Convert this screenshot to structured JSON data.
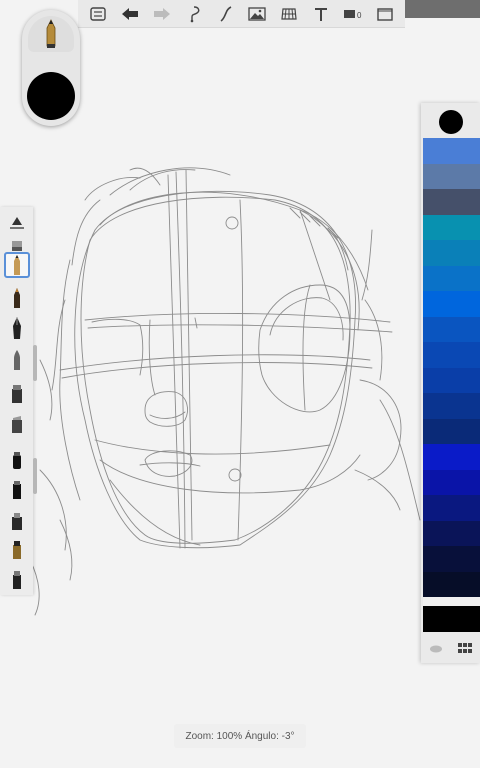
{
  "toolbar": {
    "buttons": [
      {
        "name": "menu-list-icon"
      },
      {
        "name": "undo-icon"
      },
      {
        "name": "redo-icon"
      },
      {
        "name": "selection-lasso-icon"
      },
      {
        "name": "curve-ruler-icon"
      },
      {
        "name": "image-icon"
      },
      {
        "name": "perspective-guide-icon"
      },
      {
        "name": "text-icon"
      },
      {
        "name": "layers-icon"
      },
      {
        "name": "fullscreen-icon"
      }
    ]
  },
  "brush_puck": {
    "selected_color": "#000000"
  },
  "tool_strip": {
    "tools": [
      {
        "name": "ruler-tool-icon"
      },
      {
        "name": "eraser-tool-icon"
      },
      {
        "name": "pencil-tool-icon",
        "selected": true
      },
      {
        "name": "ballpoint-pen-icon"
      },
      {
        "name": "fountain-pen-icon"
      },
      {
        "name": "brush-tool-icon"
      },
      {
        "name": "marker-tool-icon"
      },
      {
        "name": "chisel-marker-icon"
      },
      {
        "name": "felt-pen-icon"
      },
      {
        "name": "wide-marker-icon"
      },
      {
        "name": "airbrush-icon"
      },
      {
        "name": "paint-bucket-icon"
      },
      {
        "name": "smudge-tool-icon"
      }
    ]
  },
  "color_panel": {
    "current_color": "#000000",
    "swatches": [
      "#4a7ed6",
      "#5c7aa8",
      "#45506a",
      "#0891b0",
      "#0a80b8",
      "#0a72c8",
      "#0066dd",
      "#0a55c0",
      "#0a48b4",
      "#0a3ea8",
      "#0a3490",
      "#0a2a78",
      "#0a1bc8",
      "#0a14a8",
      "#0a1880",
      "#0a1458",
      "#08103a",
      "#060d28",
      "#f0f0f0"
    ],
    "black_swatch": "#000000"
  },
  "status": {
    "text": "Zoom: 100%  Ángulo: -3°"
  }
}
